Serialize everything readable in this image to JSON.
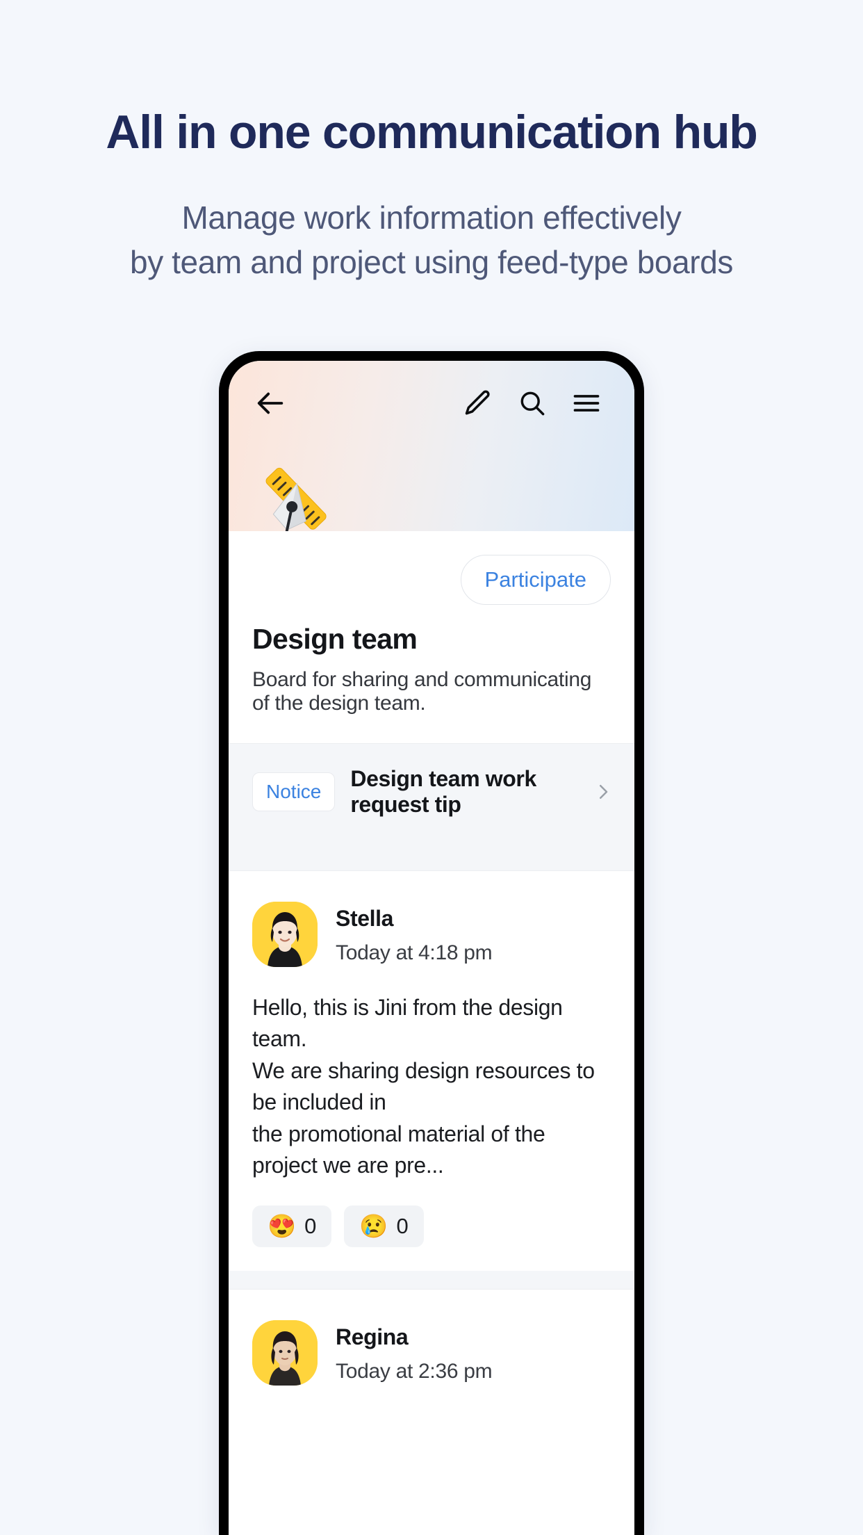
{
  "hero": {
    "title": "All in one communication hub",
    "subtitle_line1": "Manage work information effectively",
    "subtitle_line2": "by team and project using feed-type boards"
  },
  "colors": {
    "hero_title": "#1f2a5a",
    "hero_subtitle": "#4e5878",
    "page_background": "#f4f7fc",
    "accent_blue": "#3b82e0",
    "avatar_yellow": "#ffd43c",
    "strip_gray": "#f4f6f9"
  },
  "app": {
    "topbar": {
      "back_icon": "arrow-left-icon",
      "compose_icon": "pencil-icon",
      "search_icon": "search-icon",
      "menu_icon": "hamburger-menu-icon"
    },
    "board": {
      "emoji": "pen-and-ruler-icon",
      "participate_label": "Participate",
      "title": "Design team",
      "description": "Board for sharing and communicating of the design team."
    },
    "notice": {
      "badge": "Notice",
      "text": "Design team work request tip",
      "chevron_icon": "chevron-right-icon"
    },
    "posts": [
      {
        "author": "Stella",
        "time": "Today at 4:18 pm",
        "body": "Hello, this is Jini from the design team.\nWe are sharing design resources to be included in\nthe promotional material of the project we are pre...",
        "reactions": [
          {
            "emoji": "😍",
            "name": "heart-eyes-reaction",
            "count": "0"
          },
          {
            "emoji": "😢",
            "name": "crying-face-reaction",
            "count": "0"
          }
        ]
      },
      {
        "author": "Regina",
        "time": "Today at 2:36 pm",
        "body": "",
        "reactions": []
      }
    ]
  }
}
